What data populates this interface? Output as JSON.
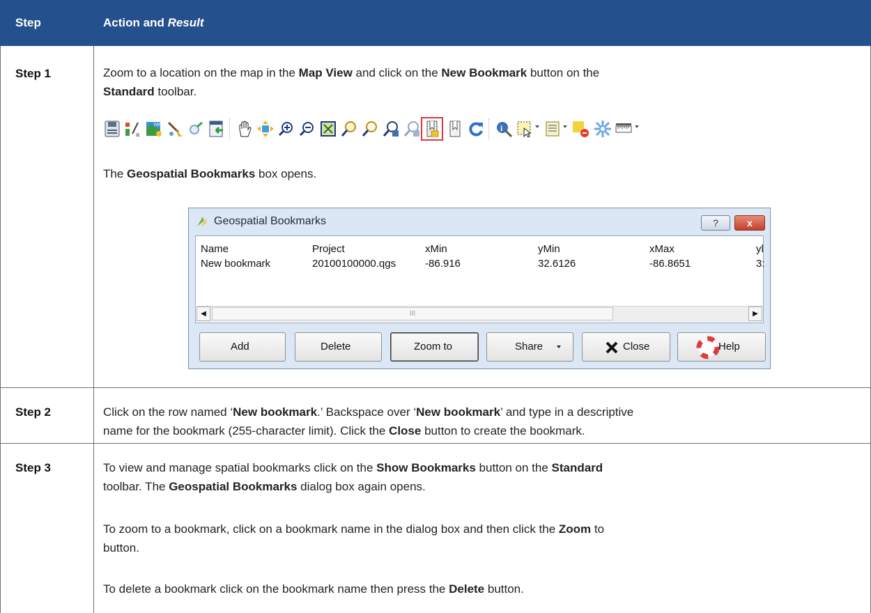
{
  "header": {
    "step": "Step",
    "action_a": "Action and ",
    "action_b": "Result"
  },
  "rows": [
    {
      "step": "Step 1"
    },
    {
      "step": "Step 2"
    },
    {
      "step": "Step 3"
    }
  ],
  "step1": {
    "p1": [
      "Zoom to a location on the map in the ",
      "Map View",
      " and click on the ",
      "New Bookmark",
      " button on the"
    ],
    "p1b": [
      "Standard",
      " toolbar."
    ],
    "p2": [
      "The ",
      "Geospatial Bookmarks",
      " box opens."
    ]
  },
  "toolbar": {
    "icons": [
      "save-icon",
      "symbology-icon",
      "map-bookmark-icon",
      "edit-brush-icon",
      "identify-circle-icon",
      "import-icon",
      "pan-hand-icon",
      "pan-to-selection-icon",
      "zoom-in-icon",
      "zoom-out-icon",
      "zoom-full-icon",
      "zoom-to-layer-icon",
      "zoom-to-selection-icon",
      "zoom-last-icon",
      "zoom-next-icon",
      "new-bookmark-icon",
      "show-bookmarks-icon",
      "refresh-icon",
      "identify-icon",
      "select-icon",
      "attribute-table-icon",
      "deselect-icon",
      "settings-icon",
      "measure-icon"
    ],
    "highlight": "new-bookmark-icon",
    "highlight_color": "#e0353a"
  },
  "dialog": {
    "title": "Geospatial Bookmarks",
    "title_help": "?",
    "title_close": "x",
    "columns": [
      "Name",
      "Project",
      "xMin",
      "yMin",
      "xMax",
      "yl"
    ],
    "row": [
      "New bookmark",
      "20100100000.qgs",
      "-86.916",
      "32.6126",
      "-86.8651",
      "3:"
    ],
    "buttons": {
      "add": "Add",
      "delete": "Delete",
      "zoom": "Zoom to",
      "share": "Share",
      "close": "Close",
      "help": "Help"
    },
    "scroll_thumb": "III"
  },
  "step2": {
    "l1": [
      "Click on the row named ‘",
      "New bookmark",
      ".’ Backspace over ‘",
      "New bookmark",
      "’ and type in a descriptive"
    ],
    "l2": [
      "name for the bookmark (255-character limit). Click the ",
      "Close",
      " button to create the bookmark."
    ]
  },
  "step3": {
    "l1": [
      "To view and manage spatial bookmarks click on the ",
      "Show Bookmarks",
      " button on the ",
      "Standard"
    ],
    "l2": [
      "toolbar. The ",
      "Geospatial Bookmarks",
      " dialog box again opens."
    ],
    "l3": [
      "To zoom to a bookmark, click on a bookmark name in the dialog box and then click the ",
      "Zoom",
      " to"
    ],
    "l4": [
      "button."
    ],
    "l5": [
      "To delete a bookmark click on the bookmark name then press the ",
      "Delete",
      " button."
    ]
  },
  "colors": {
    "header_bg": "#24518d",
    "grid": "#6f6f6f"
  }
}
